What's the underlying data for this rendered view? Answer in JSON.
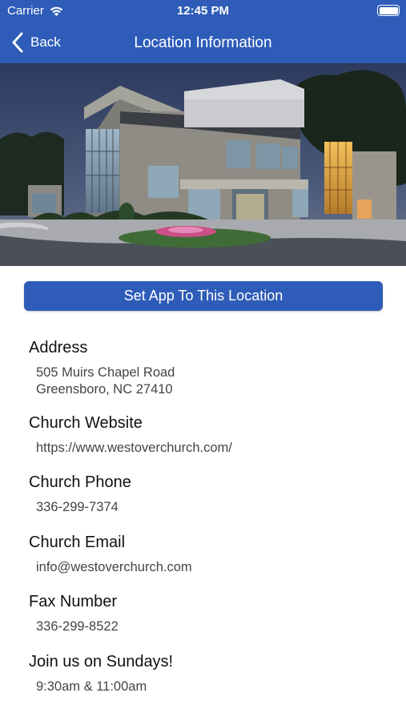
{
  "status_bar": {
    "carrier": "Carrier",
    "time": "12:45 PM"
  },
  "nav": {
    "back_label": "Back",
    "title": "Location Information"
  },
  "hero": {
    "image_description": "church building photo"
  },
  "actions": {
    "set_location_label": "Set App To This Location"
  },
  "info": {
    "address": {
      "label": "Address",
      "line1": "505 Muirs Chapel Road",
      "line2": "Greensboro, NC 27410"
    },
    "website": {
      "label": "Church Website",
      "value": "https://www.westoverchurch.com/"
    },
    "phone": {
      "label": "Church Phone",
      "value": "336-299-7374"
    },
    "email": {
      "label": "Church Email",
      "value": "info@westoverchurch.com"
    },
    "fax": {
      "label": "Fax Number",
      "value": "336-299-8522"
    },
    "sundays": {
      "label": "Join us on Sundays!",
      "value": "9:30am & 11:00am"
    }
  },
  "colors": {
    "brand_blue": "#2e5cb8"
  }
}
